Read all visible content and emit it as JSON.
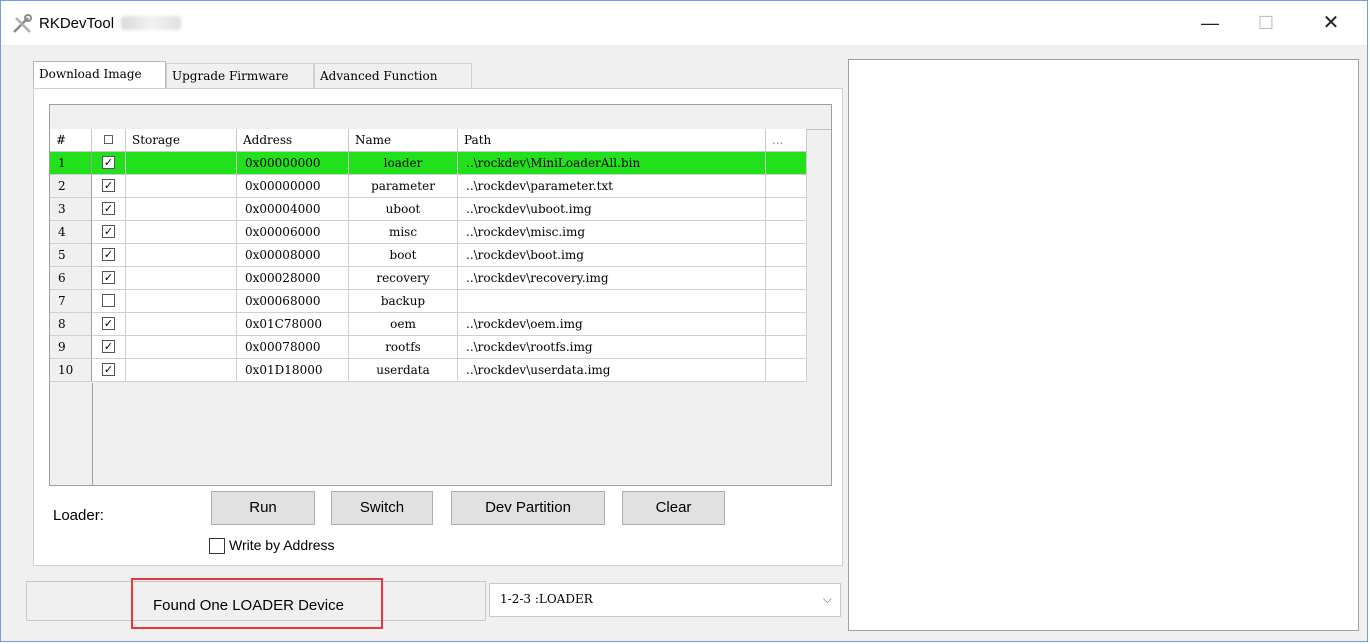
{
  "window": {
    "title": "RKDevTool",
    "controls": {
      "minimize": "—",
      "maximize": "☐",
      "close": "✕"
    }
  },
  "tabs": [
    {
      "label": "Download Image",
      "active": true
    },
    {
      "label": "Upgrade Firmware",
      "active": false
    },
    {
      "label": "Advanced Function",
      "active": false
    }
  ],
  "table": {
    "headers": {
      "num": "#",
      "check": "☐",
      "storage": "Storage",
      "address": "Address",
      "name": "Name",
      "path": "Path",
      "more": "..."
    },
    "rows": [
      {
        "num": "1",
        "checked": true,
        "storage": "",
        "address": "0x00000000",
        "name": "loader",
        "path": "..\\rockdev\\MiniLoaderAll.bin",
        "selected": true
      },
      {
        "num": "2",
        "checked": true,
        "storage": "",
        "address": "0x00000000",
        "name": "parameter",
        "path": "..\\rockdev\\parameter.txt"
      },
      {
        "num": "3",
        "checked": true,
        "storage": "",
        "address": "0x00004000",
        "name": "uboot",
        "path": "..\\rockdev\\uboot.img"
      },
      {
        "num": "4",
        "checked": true,
        "storage": "",
        "address": "0x00006000",
        "name": "misc",
        "path": "..\\rockdev\\misc.img"
      },
      {
        "num": "5",
        "checked": true,
        "storage": "",
        "address": "0x00008000",
        "name": "boot",
        "path": "..\\rockdev\\boot.img"
      },
      {
        "num": "6",
        "checked": true,
        "storage": "",
        "address": "0x00028000",
        "name": "recovery",
        "path": "..\\rockdev\\recovery.img"
      },
      {
        "num": "7",
        "checked": false,
        "storage": "",
        "address": "0x00068000",
        "name": "backup",
        "path": ""
      },
      {
        "num": "8",
        "checked": true,
        "storage": "",
        "address": "0x01C78000",
        "name": "oem",
        "path": "..\\rockdev\\oem.img"
      },
      {
        "num": "9",
        "checked": true,
        "storage": "",
        "address": "0x00078000",
        "name": "rootfs",
        "path": "..\\rockdev\\rootfs.img"
      },
      {
        "num": "10",
        "checked": true,
        "storage": "",
        "address": "0x01D18000",
        "name": "userdata",
        "path": "..\\rockdev\\userdata.img"
      }
    ],
    "selected_color": "#22e01b"
  },
  "controls": {
    "loader_label": "Loader:",
    "run": "Run",
    "switch": "Switch",
    "dev_partition": "Dev Partition",
    "clear": "Clear",
    "write_by_address": "Write by Address"
  },
  "status": {
    "message": "Found One LOADER Device",
    "device": "1-2-3 :LOADER",
    "highlight_color": "#e8383d"
  }
}
